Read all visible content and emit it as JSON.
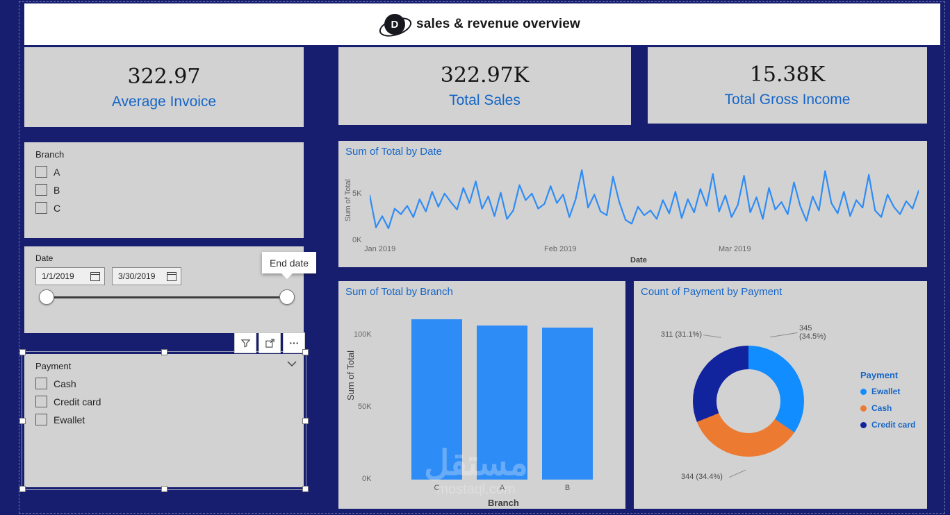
{
  "colors": {
    "background": "#171E6F",
    "card_bg": "#D2D2D2",
    "accent_blue": "#1666C8",
    "line_blue": "#2E8CF6",
    "bar_blue": "#2E8CF6"
  },
  "header": {
    "logo_letter": "D",
    "title": "sales & revenue overview"
  },
  "kpis": [
    {
      "value": "322.97",
      "label": "Average Invoice"
    },
    {
      "value": "322.97K",
      "label": "Total Sales"
    },
    {
      "value": "15.38K",
      "label": "Total Gross Income"
    }
  ],
  "slicers": {
    "branch": {
      "title": "Branch",
      "options": [
        "A",
        "B",
        "C"
      ]
    },
    "date": {
      "title": "Date",
      "start_value": "1/1/2019",
      "end_value": "3/30/2019",
      "tooltip": "End date"
    },
    "payment": {
      "title": "Payment",
      "options": [
        "Cash",
        "Credit card",
        "Ewallet"
      ]
    }
  },
  "chart_data": [
    {
      "type": "line",
      "title": "Sum of Total by Date",
      "xlabel": "Date",
      "ylabel": "Sum of Total",
      "unit": "K",
      "ylim": [
        0,
        7.9
      ],
      "yticks": [
        "0K",
        "5K"
      ],
      "xticks": [
        "Jan 2019",
        "Feb 2019",
        "Mar 2019"
      ],
      "values": [
        4.9,
        1.5,
        2.7,
        1.4,
        3.5,
        2.9,
        3.8,
        2.6,
        4.5,
        3.2,
        5.3,
        3.7,
        5.1,
        4.2,
        3.4,
        5.7,
        4.1,
        6.4,
        3.5,
        4.8,
        2.7,
        5.2,
        2.4,
        3.3,
        6.0,
        4.4,
        5.1,
        3.5,
        4.0,
        5.9,
        4.1,
        5.0,
        2.6,
        4.5,
        7.6,
        3.6,
        5.0,
        3.2,
        2.8,
        6.9,
        4.2,
        2.3,
        1.9,
        3.7,
        2.8,
        3.3,
        2.4,
        4.4,
        3.0,
        5.3,
        2.5,
        4.5,
        3.1,
        5.6,
        3.8,
        7.2,
        3.2,
        4.9,
        2.6,
        3.9,
        7.0,
        3.1,
        4.7,
        2.4,
        5.7,
        3.4,
        4.2,
        2.9,
        6.3,
        3.8,
        2.2,
        4.8,
        3.3,
        7.5,
        4.1,
        3.0,
        5.3,
        2.7,
        4.4,
        3.6,
        7.1,
        3.3,
        2.6,
        5.0,
        3.7,
        2.9,
        4.3,
        3.5,
        5.4
      ]
    },
    {
      "type": "bar",
      "title": "Sum of Total by Branch",
      "xlabel": "Branch",
      "ylabel": "Sum of Total",
      "unit": "K",
      "ylim": [
        0,
        118
      ],
      "yticks": [
        "0K",
        "50K",
        "100K"
      ],
      "categories": [
        "C",
        "A",
        "B"
      ],
      "values": [
        110.6,
        106.3,
        105.3
      ]
    },
    {
      "type": "donut",
      "title": "Count of Payment by Payment",
      "legend_title": "Payment",
      "slices": [
        {
          "name": "Ewallet",
          "count": 345,
          "pct": 34.5,
          "color": "#118DFF"
        },
        {
          "name": "Cash",
          "count": 344,
          "pct": 34.4,
          "color": "#EC7A30"
        },
        {
          "name": "Credit card",
          "count": 311,
          "pct": 31.1,
          "color": "#12239E"
        }
      ],
      "callouts": {
        "ewallet_line1": "345",
        "ewallet_line2": "(34.5%)",
        "credit": "311 (31.1%)",
        "cash": "344 (34.4%)"
      }
    }
  ],
  "watermark": {
    "text": "مستقل",
    "subtext": "mostaql.com"
  }
}
